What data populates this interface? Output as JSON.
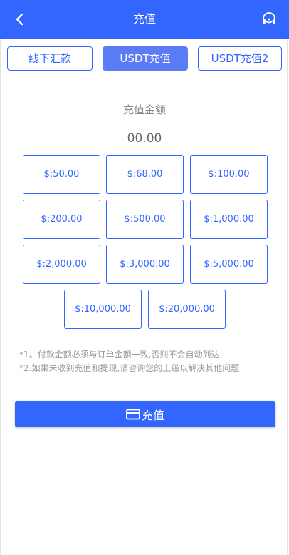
{
  "header": {
    "title": "充值"
  },
  "tabs": [
    {
      "label": "线下汇款",
      "active": false
    },
    {
      "label": "USDT充值",
      "active": true
    },
    {
      "label": "USDT充值2",
      "active": false
    }
  ],
  "amount": {
    "label": "充值金额",
    "value": "00.00"
  },
  "amount_options": [
    "$:50.00",
    "$:68.00",
    "$:100.00",
    "$:200.00",
    "$:500.00",
    "$:1,000.00",
    "$:2,000.00",
    "$:3,000.00",
    "$:5,000.00",
    "$:10,000.00",
    "$:20,000.00"
  ],
  "notes": [
    "*1。付款金额必须与订单金额一致,否则不会自动到达",
    "*2.如果未收到充值和提现,请咨询您的上级以解决其他问题"
  ],
  "submit": {
    "label": "充值"
  },
  "colors": {
    "primary": "#3366ff",
    "active_tab": "#5c7cf5"
  }
}
